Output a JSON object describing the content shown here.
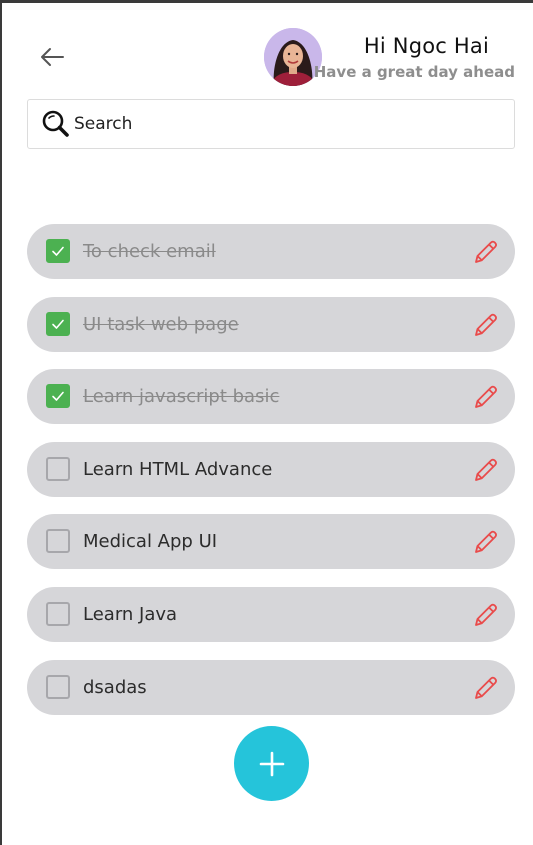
{
  "header": {
    "back_icon": "arrow-left-icon",
    "greeting_title": "Hi Ngoc Hai",
    "greeting_subtitle": "Have a great day ahead",
    "avatar_icon": "user-avatar"
  },
  "search": {
    "icon": "search-icon",
    "placeholder": "Search",
    "value": ""
  },
  "tasks": [
    {
      "label": "To check email",
      "done": true
    },
    {
      "label": "UI task web page",
      "done": true
    },
    {
      "label": "Learn javascript basic",
      "done": true
    },
    {
      "label": "Learn HTML Advance",
      "done": false
    },
    {
      "label": "Medical App UI",
      "done": false
    },
    {
      "label": "Learn Java",
      "done": false
    },
    {
      "label": "dsadas",
      "done": false
    }
  ],
  "add_button": {
    "icon": "plus-icon"
  },
  "colors": {
    "accent": "#25c4da",
    "check": "#4cb151",
    "edit": "#e94b4b",
    "task_bg": "#d6d6d9"
  }
}
